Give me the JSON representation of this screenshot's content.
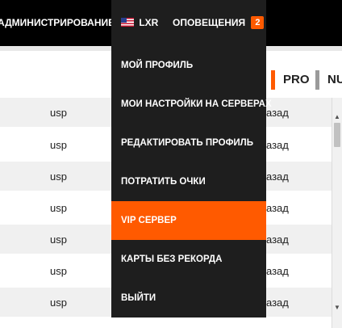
{
  "nav": {
    "admin_label": "АДМИНИСТРИРОВАНИЕ",
    "user_label": "LXR",
    "alerts_label": "ОПОВЕЩЕНИЯ",
    "alerts_count": "2"
  },
  "tabs": {
    "pro": "PRO",
    "nub": "NUB"
  },
  "table": {
    "rows": [
      {
        "col1": "usp",
        "col2": "азад"
      },
      {
        "col1": "usp",
        "col2": "азад"
      },
      {
        "col1": "usp",
        "col2": "азад"
      },
      {
        "col1": "usp",
        "col2": "азад"
      },
      {
        "col1": "usp",
        "col2": "азад"
      },
      {
        "col1": "usp",
        "col2": "азад"
      },
      {
        "col1": "usp",
        "col2": "азад"
      }
    ]
  },
  "menu": {
    "items": [
      {
        "label": "МОЙ ПРОФИЛЬ"
      },
      {
        "label": "МОИ НАСТРОЙКИ НА СЕРВЕРАХ"
      },
      {
        "label": "РЕДАКТИРОВАТЬ ПРОФИЛЬ"
      },
      {
        "label": "ПОТРАТИТЬ ОЧКИ"
      },
      {
        "label": "VIP СЕРВЕР"
      },
      {
        "label": "КАРТЫ БЕЗ РЕКОРДА"
      },
      {
        "label": "ВЫЙТИ"
      }
    ],
    "active_item": "VIP СЕРВЕР"
  },
  "colors": {
    "accent": "#ff5a00",
    "nav_bg": "#000000",
    "menu_bg": "#1e1e1e",
    "row_alt": "#f0f0f0"
  },
  "icons": {
    "user_flag": "us-flag-icon",
    "scroll_up": "scroll-up-arrow-icon",
    "scroll_down": "scroll-down-arrow-icon"
  }
}
